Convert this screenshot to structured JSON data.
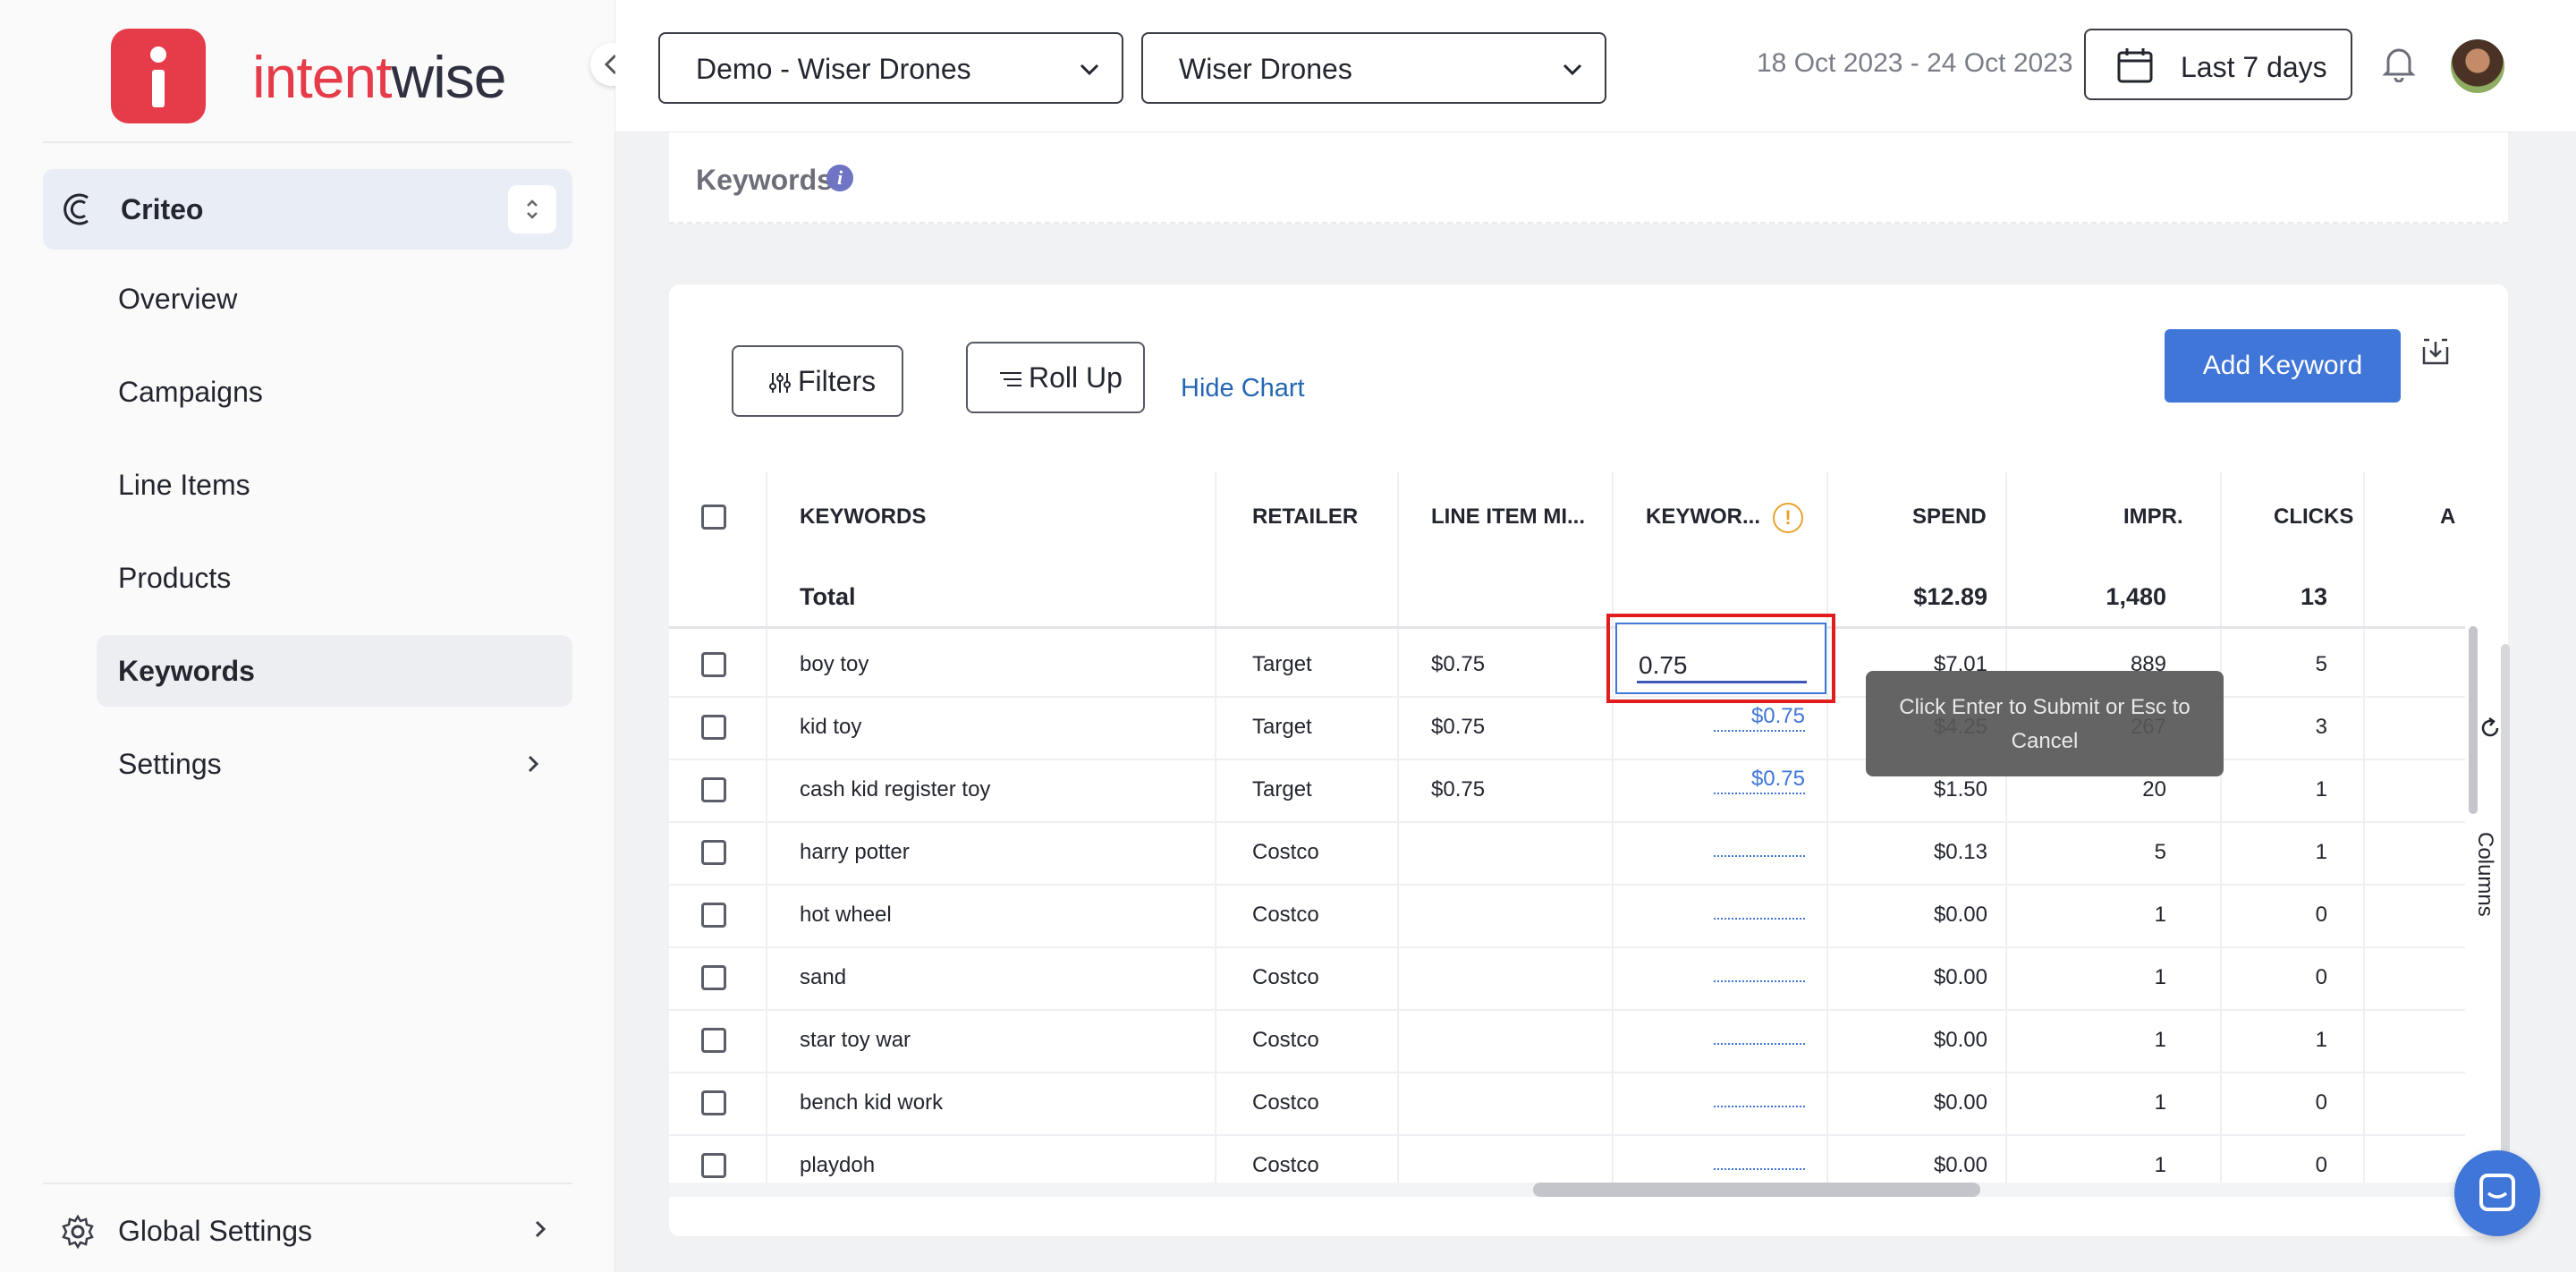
{
  "brand": {
    "name_left": "intent",
    "name_right": "wise",
    "accent": "#e63b48"
  },
  "sidebar": {
    "platform": "Criteo",
    "items": [
      {
        "label": "Overview"
      },
      {
        "label": "Campaigns"
      },
      {
        "label": "Line Items"
      },
      {
        "label": "Products"
      },
      {
        "label": "Keywords",
        "active": true
      },
      {
        "label": "Settings",
        "has_submenu": true
      }
    ],
    "footer": {
      "label": "Global Settings"
    }
  },
  "header": {
    "account_select": "Demo - Wiser Drones",
    "brand_select": "Wiser Drones",
    "date_range": "18 Oct 2023 - 24 Oct 2023",
    "range_button": "Last 7 days"
  },
  "section": {
    "title": "Keywords"
  },
  "toolbar": {
    "filters": "Filters",
    "rollup": "Roll Up",
    "hide_chart": "Hide Chart",
    "add_keyword": "Add Keyword"
  },
  "table": {
    "columns": [
      "KEYWORDS",
      "RETAILER",
      "LINE ITEM MI...",
      "KEYWOR...",
      "SPEND",
      "IMPR.",
      "CLICKS",
      "A"
    ],
    "total": {
      "label": "Total",
      "spend": "$12.89",
      "impr": "1,480",
      "clicks": "13"
    },
    "rows": [
      {
        "keyword": "boy toy",
        "retailer": "Target",
        "line_item_min": "$0.75",
        "bid": "",
        "spend": "$7.01",
        "impr": "889",
        "clicks": "5"
      },
      {
        "keyword": "kid toy",
        "retailer": "Target",
        "line_item_min": "$0.75",
        "bid": "$0.75",
        "spend": "$4.25",
        "impr": "267",
        "clicks": "3"
      },
      {
        "keyword": "cash kid register toy",
        "retailer": "Target",
        "line_item_min": "$0.75",
        "bid": "$0.75",
        "spend": "$1.50",
        "impr": "20",
        "clicks": "1"
      },
      {
        "keyword": "harry potter",
        "retailer": "Costco",
        "line_item_min": "",
        "bid": "",
        "spend": "$0.13",
        "impr": "5",
        "clicks": "1"
      },
      {
        "keyword": "hot wheel",
        "retailer": "Costco",
        "line_item_min": "",
        "bid": "",
        "spend": "$0.00",
        "impr": "1",
        "clicks": "0"
      },
      {
        "keyword": "sand",
        "retailer": "Costco",
        "line_item_min": "",
        "bid": "",
        "spend": "$0.00",
        "impr": "1",
        "clicks": "0"
      },
      {
        "keyword": "star toy war",
        "retailer": "Costco",
        "line_item_min": "",
        "bid": "",
        "spend": "$0.00",
        "impr": "1",
        "clicks": "1"
      },
      {
        "keyword": "bench kid work",
        "retailer": "Costco",
        "line_item_min": "",
        "bid": "",
        "spend": "$0.00",
        "impr": "1",
        "clicks": "0"
      },
      {
        "keyword": "playdoh",
        "retailer": "Costco",
        "line_item_min": "",
        "bid": "",
        "spend": "$0.00",
        "impr": "1",
        "clicks": "0"
      }
    ]
  },
  "inline_edit": {
    "value": "0.75",
    "tooltip": "Click Enter to Submit or Esc to Cancel"
  },
  "columns_panel": {
    "label": "Columns"
  }
}
